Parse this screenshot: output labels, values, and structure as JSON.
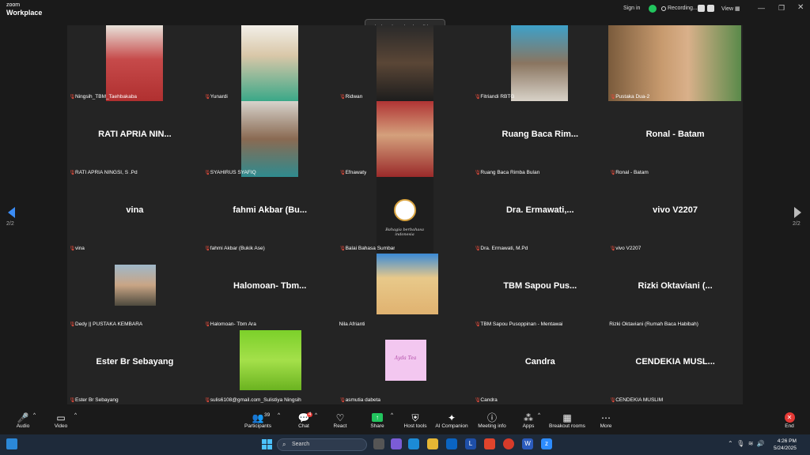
{
  "titlebar": {
    "logo_line1": "zoom",
    "logo_line2": "Workplace",
    "sign_in": "Sign in",
    "recording": "Recording...",
    "view": "View",
    "colors": {
      "shield": "#22c55e"
    }
  },
  "talking_toast": "Khairatul Annisa is talking...",
  "pagination": {
    "left_page": "2/2",
    "right_page": "2/2"
  },
  "tiles": [
    {
      "name": "Ningsih_TBM_Taehbakaba",
      "center": ""
    },
    {
      "name": "Yunardi",
      "center": ""
    },
    {
      "name": "Ridwan",
      "center": ""
    },
    {
      "name": "Fitriandi RBTG",
      "center": ""
    },
    {
      "name": "Pustaka Dua-2",
      "center": ""
    },
    {
      "name": "RATI APRIA NINGSI, S .Pd",
      "center": "RATI APRIA NIN..."
    },
    {
      "name": "SYAHIRUS SYAFIQ",
      "center": ""
    },
    {
      "name": "Efnawaty",
      "center": ""
    },
    {
      "name": "Ruang Baca Rimba Bulan",
      "center": "Ruang Baca Rim..."
    },
    {
      "name": "Ronal - Batam",
      "center": "Ronal - Batam"
    },
    {
      "name": "vina",
      "center": "vina"
    },
    {
      "name": "fahmi Akbar (Bukik Ase)",
      "center": "fahmi Akbar (Bu..."
    },
    {
      "name": "Balai Bahasa Sumbar",
      "center": ""
    },
    {
      "name": "Dra. Ermawati, M.Pd",
      "center": "Dra. Ermawati,..."
    },
    {
      "name": "vivo V2207",
      "center": "vivo V2207"
    },
    {
      "name": "Dedy || PUSTAKA KEMBARA",
      "center": ""
    },
    {
      "name": "Halomoan- Tbm Ara",
      "center": "Halomoan- Tbm..."
    },
    {
      "name": "Nila Afrianti",
      "center": ""
    },
    {
      "name": "TBM Sapou Pusoppinan - Mentawai",
      "center": "TBM Sapou Pus..."
    },
    {
      "name": "Rizki Oktaviani (Rumah Baca Habibah)",
      "center": "Rizki Oktaviani (..."
    },
    {
      "name": "Ester Br Sebayang",
      "center": "Ester Br Sebayang"
    },
    {
      "name": "sulis6108@gmail.com_Sulistiya Ningsih",
      "center": ""
    },
    {
      "name": "asmutia dabeta",
      "center": ""
    },
    {
      "name": "Candra",
      "center": "Candra"
    },
    {
      "name": "CENDEKIA MUSLIM",
      "center": "CENDEKIA MUSL..."
    }
  ],
  "balai_caption": "Bahagia berbahasa indonesia",
  "asmutia_caption": "Ayda Tea",
  "toolbar": {
    "audio": "Audio",
    "video": "Video",
    "participants": "Participants",
    "participants_count": "39",
    "chat": "Chat",
    "chat_badge": "4",
    "react": "React",
    "share": "Share",
    "host_tools": "Host tools",
    "ai_companion": "AI Companion",
    "meeting_info": "Meeting info",
    "apps": "Apps",
    "breakout_rooms": "Breakout rooms",
    "more": "More",
    "end": "End",
    "colors": {
      "share": "#22c55e",
      "end": "#e53935",
      "badge": "#e53935"
    }
  },
  "taskbar": {
    "search_placeholder": "Search",
    "time": "4:26 PM",
    "date": "5/24/2025"
  }
}
